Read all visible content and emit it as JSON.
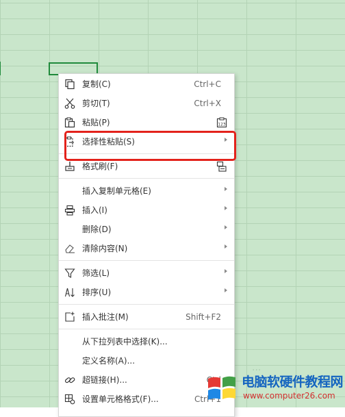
{
  "context_menu": {
    "items": [
      {
        "label": "复制(C)",
        "shortcut": "Ctrl+C",
        "icon": "copy-icon"
      },
      {
        "label": "剪切(T)",
        "shortcut": "Ctrl+X",
        "icon": "scissors-icon"
      },
      {
        "label": "粘贴(P)",
        "icon": "paste-icon",
        "right_icon": "paste-values-icon",
        "right_icon_text": "123"
      },
      {
        "label": "选择性粘贴(S)",
        "icon": "paste-special-icon",
        "submenu": true,
        "highlighted": true
      },
      {
        "label": "格式刷(F)",
        "icon": "format-painter-icon",
        "right_icon": "format-painter-icon"
      },
      {
        "label": "插入复制单元格(E)",
        "submenu": true
      },
      {
        "label": "插入(I)",
        "icon": "insert-icon",
        "submenu": true
      },
      {
        "label": "删除(D)",
        "submenu": true
      },
      {
        "label": "清除内容(N)",
        "icon": "eraser-icon",
        "submenu": true
      },
      {
        "label": "筛选(L)",
        "icon": "filter-icon",
        "submenu": true
      },
      {
        "label": "排序(U)",
        "icon": "sort-icon",
        "submenu": true
      },
      {
        "label": "插入批注(M)",
        "shortcut": "Shift+F2",
        "icon": "comment-icon"
      },
      {
        "label": "从下拉列表中选择(K)..."
      },
      {
        "label": "定义名称(A)..."
      },
      {
        "label": "超链接(H)...",
        "shortcut": "Ctrl",
        "icon": "link-icon"
      },
      {
        "label": "设置单元格格式(F)...",
        "shortcut": "Ctrl+1",
        "icon": "cell-format-icon"
      }
    ]
  },
  "colors": {
    "highlight_box": "#e3221b",
    "sheet_bg": "#c9e6cb",
    "selection": "#1f8a3b"
  },
  "watermark": {
    "faint_text": "...",
    "site_name": "电脑软硬件教程网",
    "url": "www.computer26.com"
  }
}
